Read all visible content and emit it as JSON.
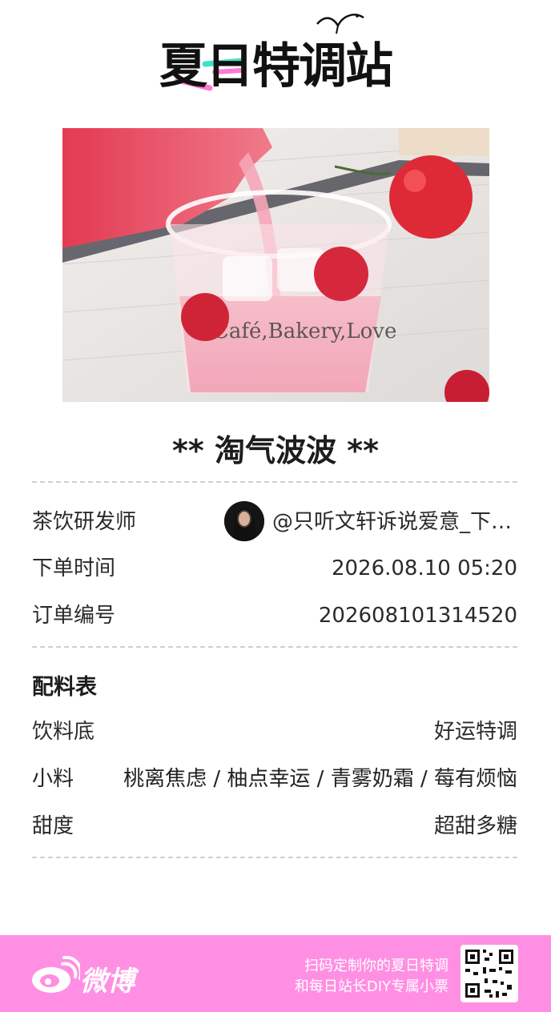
{
  "header": {
    "logo_text": "夏日特调站"
  },
  "drink": {
    "title": "** 淘气波波 **"
  },
  "order": {
    "developer_label": "茶饮研发师",
    "developer_value": "@只听文轩诉说爱意_下…",
    "time_label": "下单时间",
    "time_value": "2026.08.10  05:20",
    "number_label": "订单编号",
    "number_value": "202608101314520"
  },
  "recipe": {
    "section_title": "配料表",
    "base_label": "饮料底",
    "base_value": "好运特调",
    "toppings_label": "小料",
    "toppings_value": "桃离焦虑 / 柚点幸运 / 青雾奶霜 / 莓有烦恼",
    "sweetness_label": "甜度",
    "sweetness_value": "超甜多糖"
  },
  "footer": {
    "brand": "微博",
    "tagline_line1": "扫码定制你的夏日特调",
    "tagline_line2": "和每日站长DIY专属小票",
    "background_color": "#ff8fe3"
  },
  "photo_icon": "drink-photo",
  "qr_icon": "qr-code-icon"
}
